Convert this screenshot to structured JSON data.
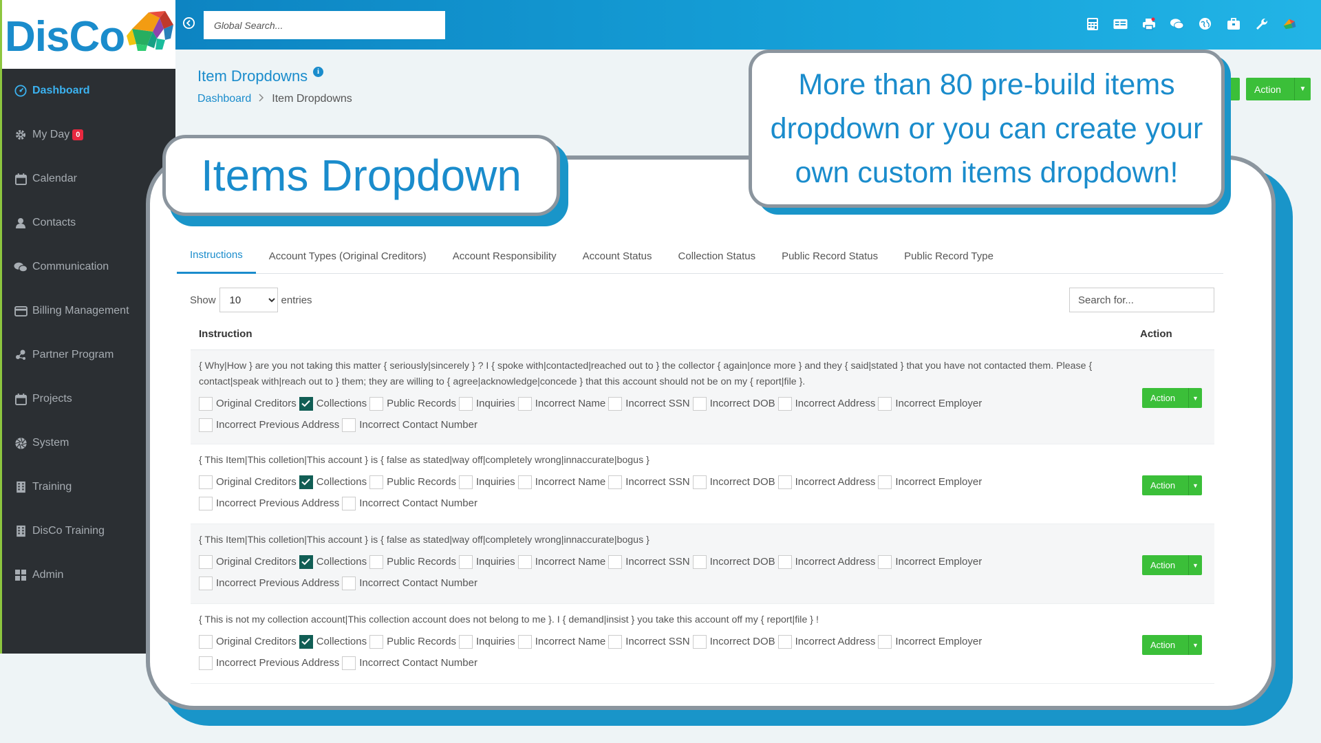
{
  "app": {
    "logo_text": "DisCo",
    "logo-mark": "elephant-logo-icon"
  },
  "sidebar": {
    "items": [
      {
        "label": "Dashboard",
        "icon": "dashboard-icon",
        "active": true
      },
      {
        "label": "My Day",
        "icon": "gear-icon",
        "badge": "0"
      },
      {
        "label": "Calendar",
        "icon": "calendar-icon"
      },
      {
        "label": "Contacts",
        "icon": "user-icon"
      },
      {
        "label": "Communication",
        "icon": "chat-icon"
      },
      {
        "label": "Billing Management",
        "icon": "credit-card-icon"
      },
      {
        "label": "Partner Program",
        "icon": "network-icon"
      },
      {
        "label": "Projects",
        "icon": "calendar-icon"
      },
      {
        "label": "System",
        "icon": "aperture-icon"
      },
      {
        "label": "Training",
        "icon": "building-icon"
      },
      {
        "label": "DisCo Training",
        "icon": "building-icon"
      },
      {
        "label": "Admin",
        "icon": "grid-icon"
      }
    ]
  },
  "topbar": {
    "search_placeholder": "Global Search...",
    "icons": [
      "calculator-icon",
      "id-card-icon",
      "print-icon",
      "comments-icon",
      "globe-icon",
      "briefcase-icon",
      "wrench-icon",
      "avatar-icon"
    ]
  },
  "page": {
    "title": "Item Dropdowns",
    "breadcrumb": [
      "Dashboard",
      "Item Dropdowns"
    ],
    "action_label": "Action"
  },
  "callouts": {
    "left": "Items Dropdown",
    "right": "More than 80 pre-build items dropdown or you can create your own custom items dropdown!"
  },
  "tabs": [
    {
      "label": "Instructions",
      "active": true
    },
    {
      "label": "Account Types (Original Creditors)"
    },
    {
      "label": "Account Responsibility"
    },
    {
      "label": "Account Status"
    },
    {
      "label": "Collection Status"
    },
    {
      "label": "Public Record Status"
    },
    {
      "label": "Public Record Type"
    }
  ],
  "table": {
    "show_label": "Show",
    "entries_label": "entries",
    "page_size": "10",
    "search_placeholder": "Search for...",
    "headers": [
      "Instruction",
      "Action"
    ],
    "action_label": "Action",
    "checkbox_labels": [
      "Original Creditors",
      "Collections",
      "Public Records",
      "Inquiries",
      "Incorrect Name",
      "Incorrect SSN",
      "Incorrect DOB",
      "Incorrect Address",
      "Incorrect Employer",
      "Incorrect Previous Address",
      "Incorrect Contact Number"
    ],
    "rows": [
      {
        "text": "{ Why|How } are you not taking this matter { seriously|sincerely } ? I { spoke with|contacted|reached out to } the collector { again|once more } and they { said|stated } that you have not contacted them. Please { contact|speak with|reach out to } them; they are willing to { agree|acknowledge|concede } that this account should not be on my { report|file }.",
        "checked": [
          false,
          true,
          false,
          false,
          false,
          false,
          false,
          false,
          false,
          false,
          false
        ]
      },
      {
        "text": "{ This Item|This colletion|This account } is { false as stated|way off|completely wrong|innaccurate|bogus }",
        "checked": [
          false,
          true,
          false,
          false,
          false,
          false,
          false,
          false,
          false,
          false,
          false
        ]
      },
      {
        "text": "{ This Item|This colletion|This account } is { false as stated|way off|completely wrong|innaccurate|bogus }",
        "checked": [
          false,
          true,
          false,
          false,
          false,
          false,
          false,
          false,
          false,
          false,
          false
        ]
      },
      {
        "text": "{ This is not my collection account|This collection account does not belong to me }. I { demand|insist } you take this account off my { report|file } !",
        "checked": [
          false,
          true,
          false,
          false,
          false,
          false,
          false,
          false,
          false,
          false,
          false
        ]
      }
    ]
  }
}
